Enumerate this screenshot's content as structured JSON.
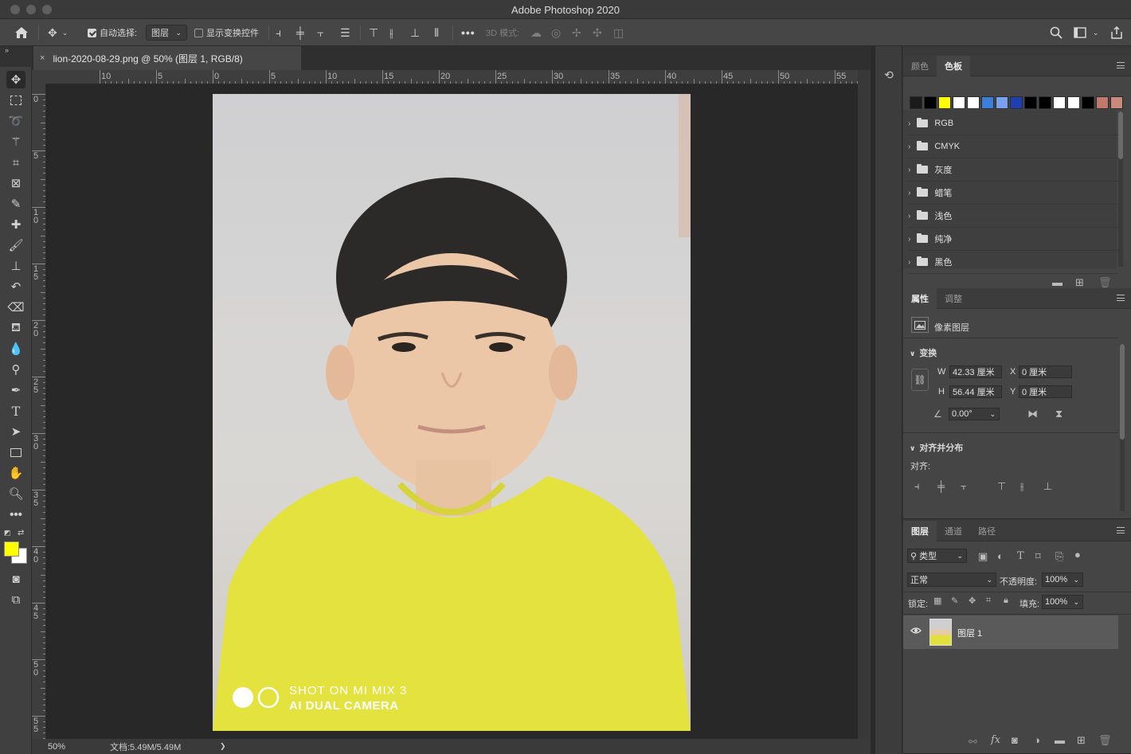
{
  "window": {
    "title": "Adobe Photoshop 2020"
  },
  "options_bar": {
    "home_icon": "home-icon",
    "move_tool_icon": "move-icon",
    "auto_select_label": "自动选择:",
    "auto_select_checked": true,
    "auto_select_target": "图层",
    "show_transform_label": "显示变换控件",
    "show_transform_checked": false,
    "more_label": "•••",
    "mode_3d_label": "3D 模式:"
  },
  "document": {
    "tab_title": "lion-2020-08-29.png @ 50% (图层 1, RGB/8)",
    "close_glyph": "×",
    "ruler_top_labels": [
      "10",
      "5",
      "0",
      "5",
      "10",
      "15",
      "20",
      "25",
      "30",
      "35",
      "40",
      "45",
      "50",
      "55"
    ],
    "ruler_left_labels": [
      "0",
      "5",
      "1\n0",
      "1\n5",
      "2\n0",
      "2\n5",
      "3\n0",
      "3\n5",
      "4\n0",
      "4\n5",
      "5\n0",
      "5\n5"
    ],
    "watermark_line1": "SHOT ON MI MIX 3",
    "watermark_line2": "AI DUAL CAMERA"
  },
  "status": {
    "zoom": "50%",
    "doc_size": "文档:5.49M/5.49M",
    "arrow": "❯"
  },
  "swatches_panel": {
    "tabs": [
      "颜色",
      "色板"
    ],
    "active_tab": "色板",
    "colors": [
      "#1a1a1a",
      "#000000",
      "#ffff00",
      "#ffffff",
      "#ffffff",
      "#3b7fd8",
      "#7aa0f0",
      "#1f3fb0",
      "#000000",
      "#000000",
      "#ffffff",
      "#ffffff",
      "#000000",
      "#c0786a",
      "#c88a7a"
    ],
    "groups": [
      "RGB",
      "CMYK",
      "灰度",
      "蜡笔",
      "浅色",
      "纯净",
      "黑色"
    ]
  },
  "properties_panel": {
    "tabs": [
      "属性",
      "调整"
    ],
    "active_tab": "属性",
    "layer_kind": "像素图层",
    "transform_header": "变换",
    "w_label": "W",
    "w_value": "42.33 厘米",
    "h_label": "H",
    "h_value": "56.44 厘米",
    "x_label": "X",
    "x_value": "0 厘米",
    "y_label": "Y",
    "y_value": "0 厘米",
    "angle_value": "0.00°",
    "align_header": "对齐并分布",
    "align_label": "对齐:"
  },
  "layers_panel": {
    "tabs": [
      "图层",
      "通道",
      "路径"
    ],
    "active_tab": "图层",
    "filter_label": "类型",
    "blend_mode": "正常",
    "opacity_label": "不透明度:",
    "opacity_value": "100%",
    "lock_label": "锁定:",
    "fill_label": "填充:",
    "fill_value": "100%",
    "layers": [
      {
        "name": "图层 1",
        "visible": true
      }
    ]
  },
  "colors": {
    "foreground": "#ffff00",
    "background": "#ffffff"
  }
}
